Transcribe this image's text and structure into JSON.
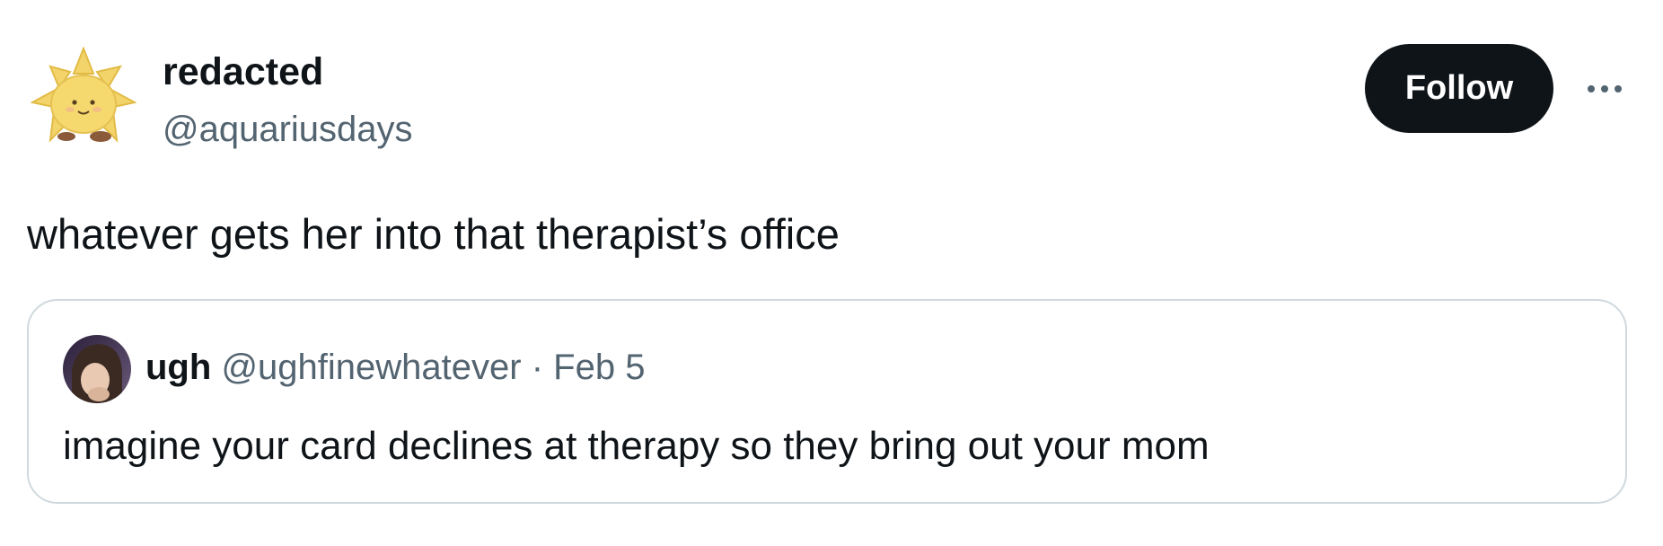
{
  "tweet": {
    "display_name": "redacted",
    "handle": "@aquariusdays",
    "text": "whatever gets her into that therapist’s office",
    "follow_label": "Follow",
    "more_icon": "more-horizontal-icon",
    "avatar_icon": "sun-plush-avatar"
  },
  "quote": {
    "display_name": "ugh",
    "handle": "@ughfinewhatever",
    "separator": "·",
    "date": "Feb 5",
    "text": "imagine your card declines at therapy so they bring out your mom",
    "avatar_icon": "profile-photo-avatar"
  },
  "colors": {
    "text_primary": "#0f1419",
    "text_secondary": "#536471",
    "button_bg": "#0f1419",
    "border": "#cfd9de"
  }
}
